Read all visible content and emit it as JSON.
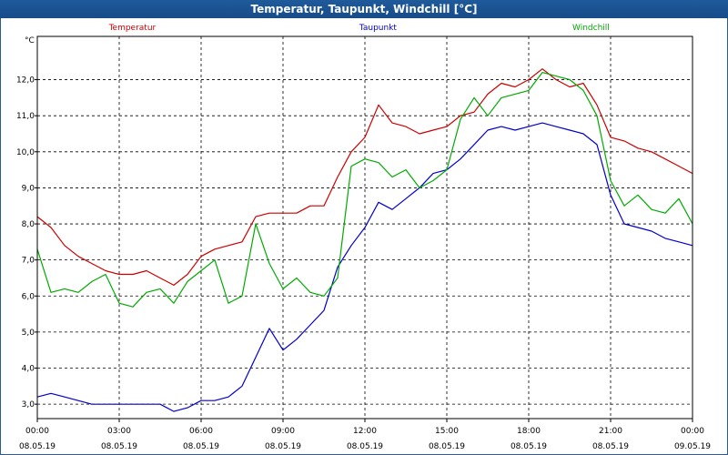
{
  "window": {
    "title": "Temperatur, Taupunkt, Windchill [°C]"
  },
  "chart_data": {
    "type": "line",
    "title": "Temperatur, Taupunkt, Windchill [°C]",
    "ylabel": "°C",
    "ylim": [
      2.6,
      13.2
    ],
    "yticks": [
      "3,0",
      "4,0",
      "5,0",
      "6,0",
      "7,0",
      "8,0",
      "9,0",
      "10,0",
      "11,0",
      "12,0"
    ],
    "ytick_values": [
      3,
      4,
      5,
      6,
      7,
      8,
      9,
      10,
      11,
      12
    ],
    "xlim": [
      0,
      24
    ],
    "xticks": [
      {
        "value": 0,
        "time": "00:00",
        "date": "08.05.19"
      },
      {
        "value": 3,
        "time": "03:00",
        "date": "08.05.19"
      },
      {
        "value": 6,
        "time": "06:00",
        "date": "08.05.19"
      },
      {
        "value": 9,
        "time": "09:00",
        "date": "08.05.19"
      },
      {
        "value": 12,
        "time": "12:00",
        "date": "08.05.19"
      },
      {
        "value": 15,
        "time": "15:00",
        "date": "08.05.19"
      },
      {
        "value": 18,
        "time": "18:00",
        "date": "08.05.19"
      },
      {
        "value": 21,
        "time": "21:00",
        "date": "08.05.19"
      },
      {
        "value": 24,
        "time": "00:00",
        "date": "09.05.19"
      }
    ],
    "grid": true,
    "legend_placement": "top",
    "series": [
      {
        "name": "Temperatur",
        "color": "#cc0000",
        "x": [
          0,
          0.5,
          1,
          1.5,
          2,
          2.5,
          3,
          3.5,
          4,
          4.5,
          5,
          5.5,
          6,
          6.5,
          7,
          7.5,
          8,
          8.5,
          9,
          9.5,
          10,
          10.5,
          11,
          11.5,
          12,
          12.5,
          13,
          13.5,
          14,
          14.5,
          15,
          15.5,
          16,
          16.5,
          17,
          17.5,
          18,
          18.5,
          19,
          19.5,
          20,
          20.5,
          21,
          21.5,
          22,
          22.5,
          23,
          23.5,
          24
        ],
        "y": [
          8.2,
          7.9,
          7.4,
          7.1,
          6.9,
          6.7,
          6.6,
          6.6,
          6.7,
          6.5,
          6.3,
          6.6,
          7.1,
          7.3,
          7.4,
          7.5,
          8.2,
          8.3,
          8.3,
          8.3,
          8.5,
          8.5,
          9.3,
          10.0,
          10.4,
          11.3,
          10.8,
          10.7,
          10.5,
          10.6,
          10.7,
          11.0,
          11.1,
          11.6,
          11.9,
          11.8,
          12.0,
          12.3,
          12.0,
          11.8,
          11.9,
          11.3,
          10.4,
          10.3,
          10.1,
          10.0,
          9.8,
          9.6,
          9.4
        ]
      },
      {
        "name": "Taupunkt",
        "color": "#0000cc",
        "x": [
          0,
          0.5,
          1,
          1.5,
          2,
          2.5,
          3,
          3.5,
          4,
          4.5,
          5,
          5.5,
          6,
          6.5,
          7,
          7.5,
          8,
          8.5,
          9,
          9.5,
          10,
          10.5,
          11,
          11.5,
          12,
          12.5,
          13,
          13.5,
          14,
          14.5,
          15,
          15.5,
          16,
          16.5,
          17,
          17.5,
          18,
          18.5,
          19,
          19.5,
          20,
          20.5,
          21,
          21.5,
          22,
          22.5,
          23,
          23.5,
          24
        ],
        "y": [
          3.2,
          3.3,
          3.2,
          3.1,
          3.0,
          3.0,
          3.0,
          3.0,
          3.0,
          3.0,
          2.8,
          2.9,
          3.1,
          3.1,
          3.2,
          3.5,
          4.3,
          5.1,
          4.5,
          4.8,
          5.2,
          5.6,
          6.8,
          7.4,
          7.9,
          8.6,
          8.4,
          8.7,
          9.0,
          9.4,
          9.5,
          9.8,
          10.2,
          10.6,
          10.7,
          10.6,
          10.7,
          10.8,
          10.7,
          10.6,
          10.5,
          10.2,
          8.8,
          8.0,
          7.9,
          7.8,
          7.6,
          7.5,
          7.4
        ]
      },
      {
        "name": "Windchill",
        "color": "#00aa00",
        "x": [
          0,
          0.5,
          1,
          1.5,
          2,
          2.5,
          3,
          3.5,
          4,
          4.5,
          5,
          5.5,
          6,
          6.5,
          7,
          7.5,
          8,
          8.5,
          9,
          9.5,
          10,
          10.5,
          11,
          11.5,
          12,
          12.5,
          13,
          13.5,
          14,
          14.5,
          15,
          15.5,
          16,
          16.5,
          17,
          17.5,
          18,
          18.5,
          19,
          19.5,
          20,
          20.5,
          21,
          21.5,
          22,
          22.5,
          23,
          23.5,
          24
        ],
        "y": [
          7.3,
          6.1,
          6.2,
          6.1,
          6.4,
          6.6,
          5.8,
          5.7,
          6.1,
          6.2,
          5.8,
          6.4,
          6.7,
          7.0,
          5.8,
          6.0,
          8.0,
          6.9,
          6.2,
          6.5,
          6.1,
          6.0,
          6.5,
          9.6,
          9.8,
          9.7,
          9.3,
          9.5,
          9.0,
          9.2,
          9.5,
          10.9,
          11.5,
          11.0,
          11.5,
          11.6,
          11.7,
          12.2,
          12.1,
          12.0,
          11.7,
          11.0,
          9.2,
          8.5,
          8.8,
          8.4,
          8.3,
          8.7,
          8.0
        ]
      }
    ]
  }
}
